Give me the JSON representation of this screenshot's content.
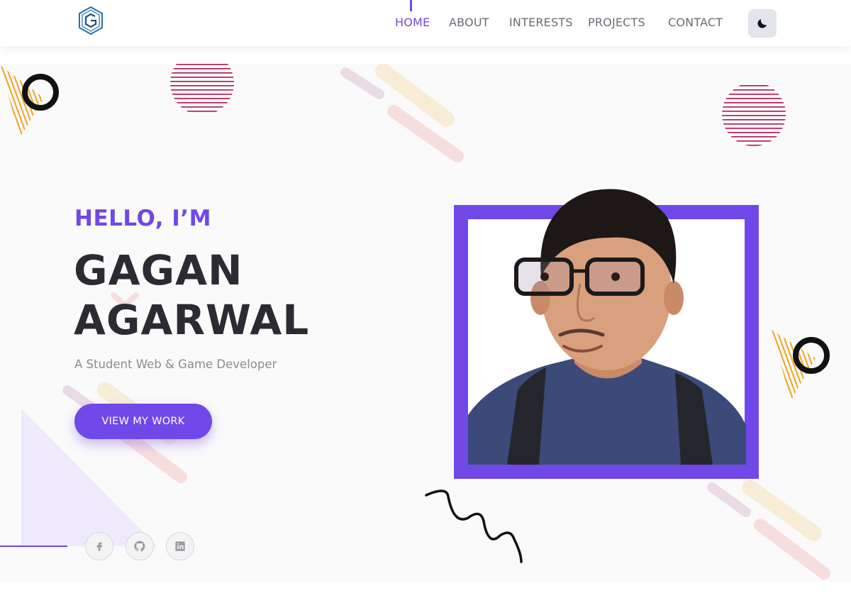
{
  "app": {
    "logo_icon": "hexagon-g-logo",
    "accent_color": "#7048e8"
  },
  "nav": {
    "items": [
      {
        "label": "HOME",
        "active": true
      },
      {
        "label": "ABOUT",
        "active": false
      },
      {
        "label": "INTERESTS",
        "active": false
      },
      {
        "label": "PROJECTS",
        "active": false
      },
      {
        "label": "CONTACT",
        "active": false
      }
    ],
    "theme_toggle_icon": "moon-icon"
  },
  "hero": {
    "greeting": "HELLO, I’M",
    "name_line1": "GAGAN",
    "name_line2": "AGARWAL",
    "subtitle": "A Student Web & Game Developer",
    "cta_label": "VIEW MY WORK",
    "photo": "profile-photo",
    "socials": [
      {
        "icon": "facebook-icon"
      },
      {
        "icon": "github-icon"
      },
      {
        "icon": "linkedin-icon"
      }
    ]
  }
}
